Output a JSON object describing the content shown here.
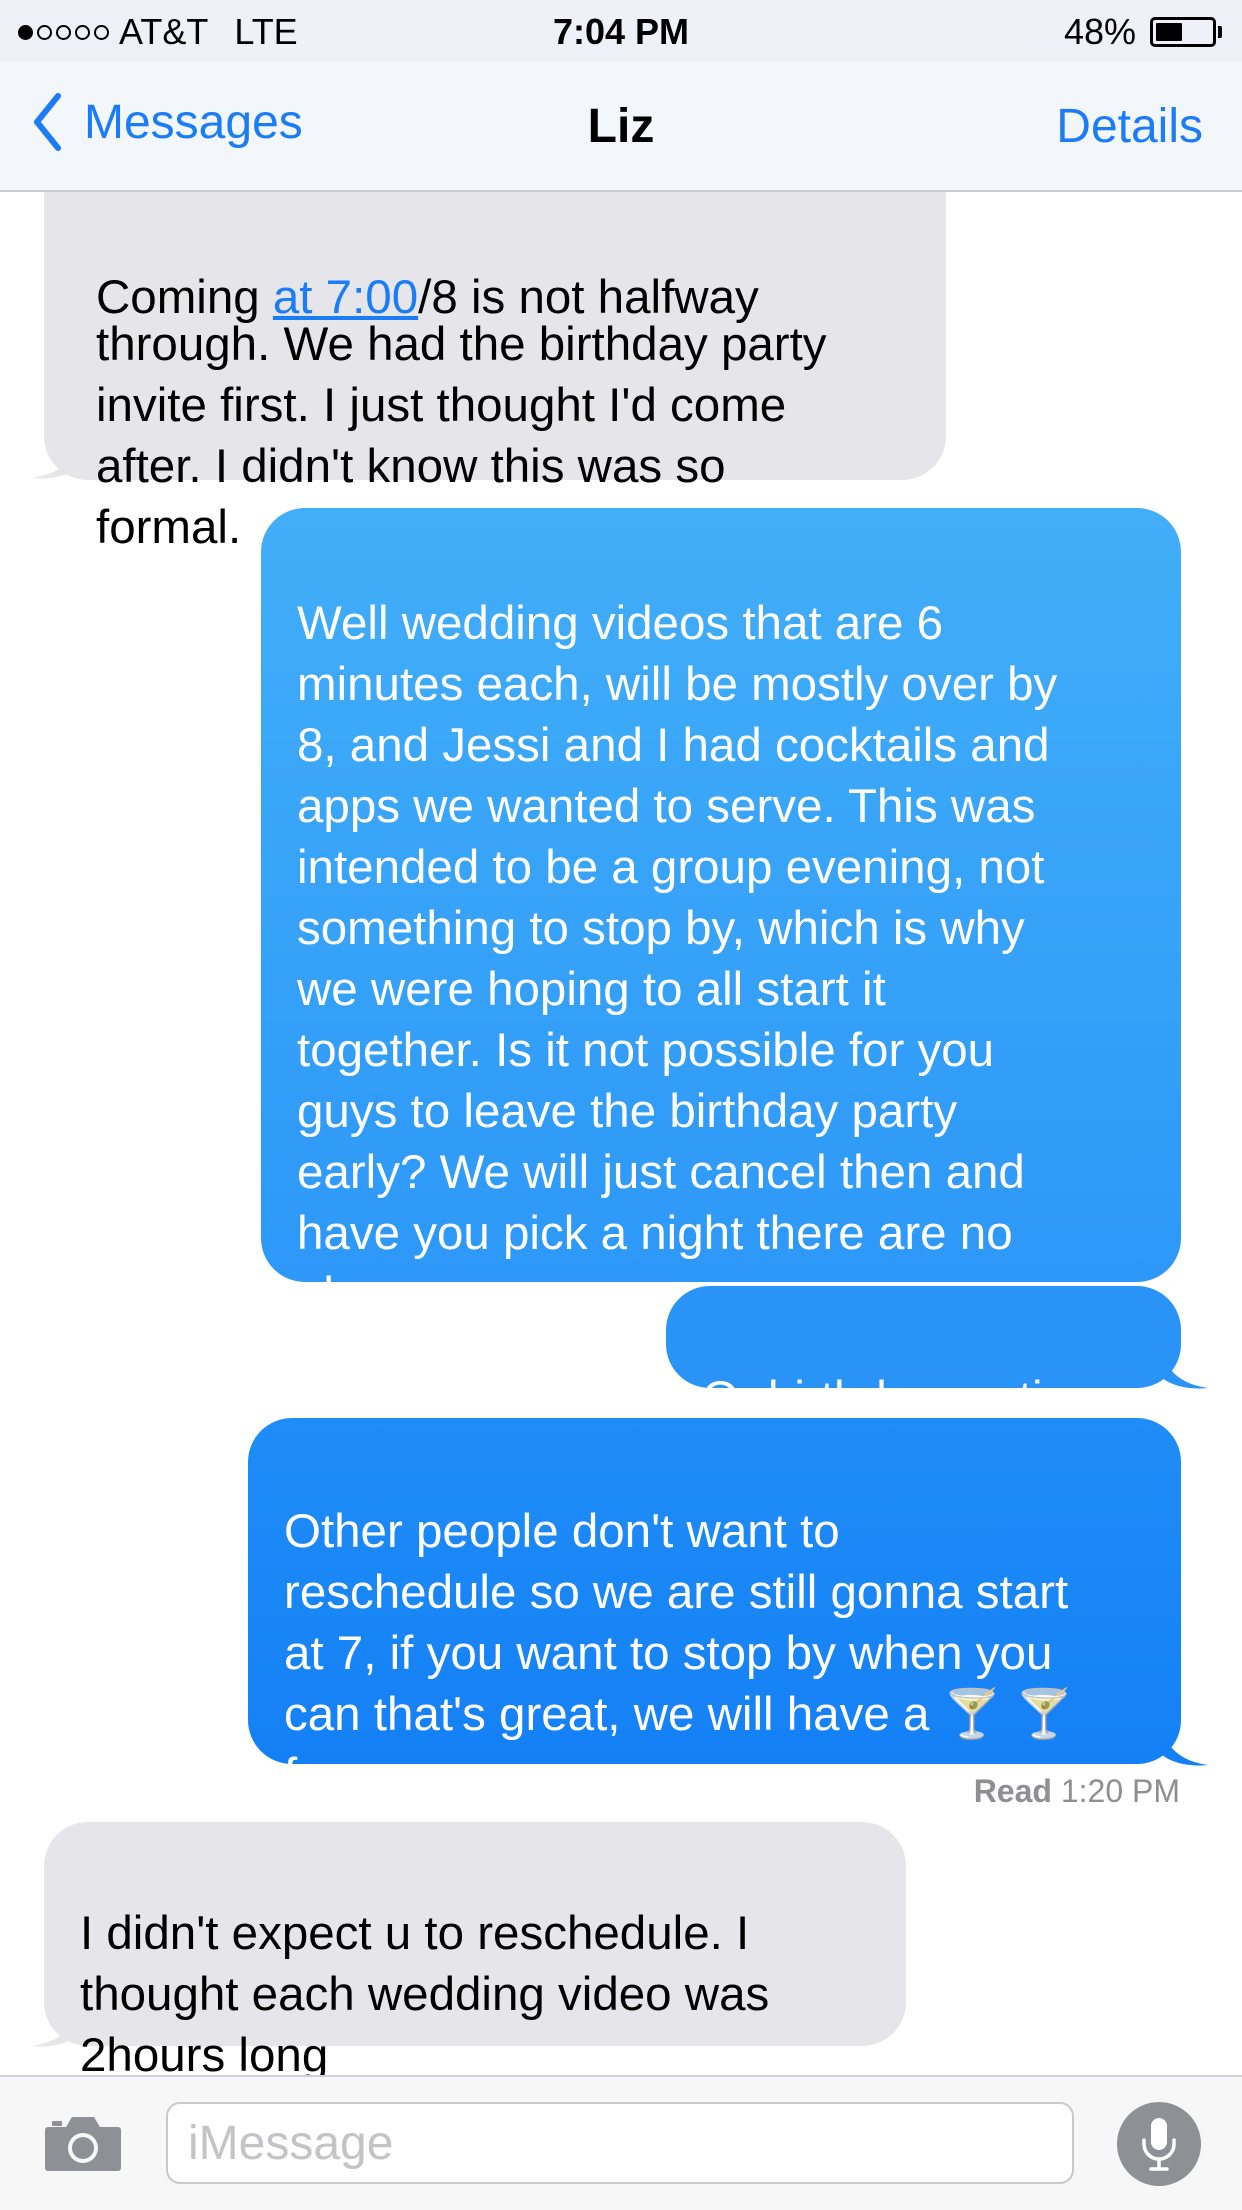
{
  "status_bar": {
    "carrier": "AT&T",
    "network": "LTE",
    "time": "7:04 PM",
    "battery_percent": "48%",
    "battery_level": 0.48,
    "signal_bars_filled": 1,
    "signal_bars_total": 5
  },
  "nav": {
    "back_label": "Messages",
    "title": "Liz",
    "details_label": "Details"
  },
  "messages": [
    {
      "direction": "incoming",
      "clipped_top_prefix": "Coming ",
      "clipped_top_link": "at 7:00",
      "clipped_top_suffix": "/8 is not halfway",
      "text": "through. We had the birthday party\ninvite first. I just thought I'd come\nafter. I didn't know this was so\nformal."
    },
    {
      "direction": "outgoing",
      "text": "Well wedding videos that are 6\nminutes each, will be mostly over by\n8, and Jessi and I had cocktails and\napps we wanted to serve. This was\nintended to be a group evening, not\nsomething to stop by, which is why\nwe were hoping to all start it\ntogether. Is it not possible for you\nguys to leave the birthday party\nearly? We will just cancel then and\nhave you pick a night there are no\nplans"
    },
    {
      "direction": "outgoing",
      "text": "Or birthday parties"
    },
    {
      "direction": "outgoing",
      "text": "Other people don't want to\nreschedule so we are still gonna start\nat 7, if you want to stop by when you\ncan that's great, we will have a 🍸 🍸\nfor you"
    },
    {
      "direction": "incoming",
      "text": "I didn't expect u to reschedule. I\nthought each wedding video was\n2hours long"
    }
  ],
  "read_receipt": {
    "label": "Read",
    "time": "1:20 PM"
  },
  "input_bar": {
    "placeholder": "iMessage"
  },
  "colors": {
    "accent": "#1a7cf6",
    "incoming_bubble": "#e5e5ea",
    "outgoing_top": "#42aef8",
    "outgoing_bottom": "#1a82f7"
  },
  "icons": [
    "chevron-left-icon",
    "camera-icon",
    "microphone-icon",
    "battery-icon",
    "signal-dots-icon"
  ]
}
